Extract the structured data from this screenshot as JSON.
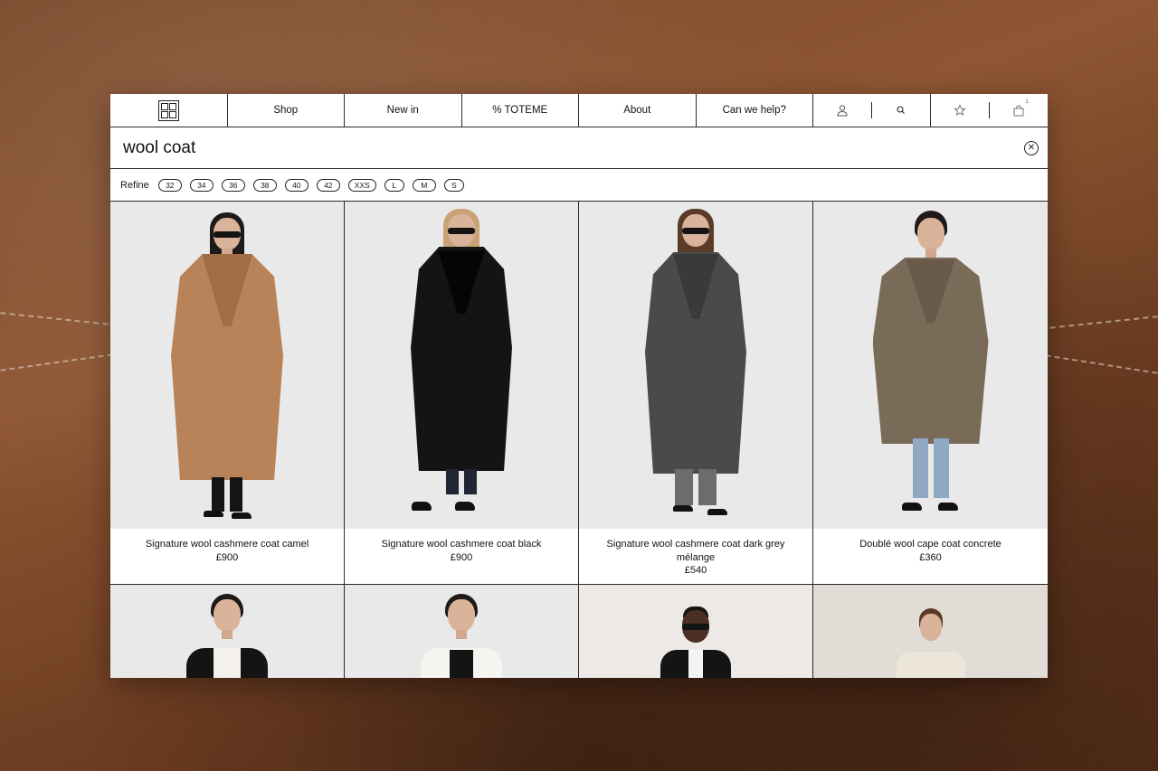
{
  "nav": {
    "items": [
      {
        "label": "Shop"
      },
      {
        "label": "New in"
      },
      {
        "label": "% TOTEME"
      },
      {
        "label": "About"
      },
      {
        "label": "Can we help?"
      }
    ],
    "icons": [
      "account-icon",
      "search-icon",
      "wishlist-star-icon",
      "bag-icon"
    ],
    "bag_count": "1"
  },
  "search": {
    "value": "wool coat"
  },
  "refine": {
    "label": "Refine",
    "sizes": [
      "32",
      "34",
      "36",
      "38",
      "40",
      "42",
      "XXS",
      "L",
      "M",
      "S"
    ]
  },
  "products": [
    {
      "name": "Signature wool cashmere coat camel",
      "price": "£900",
      "coat_color": "#b88358"
    },
    {
      "name": "Signature wool cashmere coat black",
      "price": "£900",
      "coat_color": "#141414"
    },
    {
      "name": "Signature wool cashmere coat dark grey mélange",
      "price": "£540",
      "coat_color": "#4a4a4a"
    },
    {
      "name": "Doublé wool cape coat concrete",
      "price": "£360",
      "coat_color": "#7a6a58"
    }
  ],
  "colors": {
    "accent": "#1a1a1a",
    "leather_background": "#8e5633",
    "photo_background": "#e9e9e9"
  }
}
